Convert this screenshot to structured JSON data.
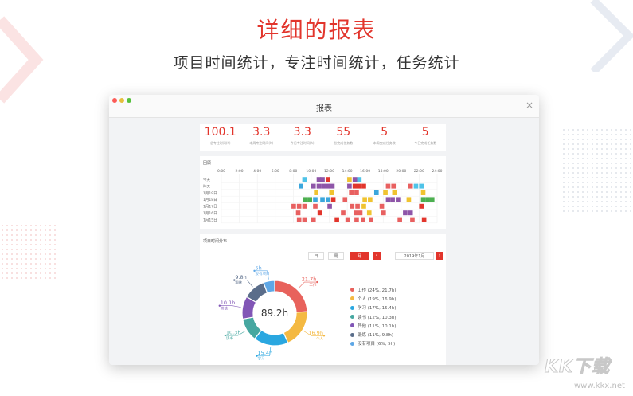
{
  "headline": "详细的报表",
  "subline": "项目时间统计，专注时间统计，任务统计",
  "window": {
    "title": "报表",
    "close_glyph": "×"
  },
  "stats": [
    {
      "value": "100.1",
      "label": "总专注时间(h)"
    },
    {
      "value": "3.3",
      "label": "本周专注时间(h)"
    },
    {
      "value": "3.3",
      "label": "今日专注时间(h)"
    },
    {
      "value": "55",
      "label": "总完成任务数"
    },
    {
      "value": "5",
      "label": "本周完成任务数"
    },
    {
      "value": "5",
      "label": "今日完成任务数"
    }
  ],
  "timeline": {
    "title": "回顾",
    "hours": [
      "0:00",
      "2:00",
      "4:00",
      "6:00",
      "8:00",
      "10:00",
      "12:00",
      "14:00",
      "16:00",
      "18:00",
      "20:00",
      "22:00",
      "24:00"
    ],
    "days": [
      "今天",
      "昨天",
      "1月19日",
      "1月18日",
      "1月17日",
      "1月16日",
      "1月15日"
    ],
    "blocks": [
      [
        [
          9,
          0.5,
          "#4fc3e8"
        ],
        [
          10.6,
          0.5,
          "#8e55a8"
        ],
        [
          11,
          0.5,
          "#8e55a8"
        ],
        [
          11.6,
          0.5,
          "#e2352c"
        ],
        [
          14,
          0.5,
          "#f0c330"
        ],
        [
          14.6,
          0.5,
          "#8e55a8"
        ],
        [
          15.1,
          0.5,
          "#4fc3e8"
        ]
      ],
      [
        [
          8.6,
          0.5,
          "#3aa6dc"
        ],
        [
          10,
          0.5,
          "#8e55a8"
        ],
        [
          10.6,
          0.5,
          "#8e55a8"
        ],
        [
          11.1,
          0.5,
          "#8e55a8"
        ],
        [
          11.6,
          0.5,
          "#8e55a8"
        ],
        [
          12.1,
          0.5,
          "#8e55a8"
        ],
        [
          14,
          0.5,
          "#8e55a8"
        ],
        [
          14.6,
          0.5,
          "#e2352c"
        ],
        [
          15.1,
          0.5,
          "#e2352c"
        ],
        [
          15.6,
          0.5,
          "#e2352c"
        ],
        [
          18.3,
          0.5,
          "#e86060"
        ],
        [
          18.9,
          0.5,
          "#e86060"
        ],
        [
          20.8,
          0.5,
          "#e86060"
        ],
        [
          21.4,
          0.5,
          "#4fc3e8"
        ],
        [
          22,
          0.5,
          "#4fc3e8"
        ]
      ],
      [
        [
          10.3,
          0.5,
          "#f0c330"
        ],
        [
          12,
          0.5,
          "#f0c330"
        ],
        [
          14.2,
          0.5,
          "#e86060"
        ],
        [
          14.8,
          0.5,
          "#e86060"
        ],
        [
          17,
          0.5,
          "#3aa6dc"
        ],
        [
          18,
          0.5,
          "#f0c330"
        ],
        [
          19,
          0.5,
          "#f0c330"
        ],
        [
          22.2,
          0.5,
          "#f0c330"
        ]
      ],
      [
        [
          9.1,
          0.5,
          "#4caf50"
        ],
        [
          9.6,
          0.5,
          "#4caf50"
        ],
        [
          10.2,
          0.5,
          "#3aa6dc"
        ],
        [
          11,
          0.5,
          "#3aa6dc"
        ],
        [
          11.6,
          0.5,
          "#3aa6dc"
        ],
        [
          12.2,
          0.5,
          "#e2352c"
        ],
        [
          13.5,
          0.5,
          "#e86060"
        ],
        [
          15.7,
          0.5,
          "#f0c330"
        ],
        [
          16.3,
          0.5,
          "#f0c330"
        ],
        [
          18.3,
          0.5,
          "#8e55a8"
        ],
        [
          18.8,
          0.5,
          "#8e55a8"
        ],
        [
          19.4,
          0.5,
          "#8e55a8"
        ],
        [
          20.6,
          0.5,
          "#f0c330"
        ],
        [
          22.2,
          0.5,
          "#4caf50"
        ],
        [
          22.7,
          0.5,
          "#4caf50"
        ],
        [
          23.2,
          0.5,
          "#4caf50"
        ]
      ],
      [
        [
          7.8,
          0.5,
          "#e86060"
        ],
        [
          8.4,
          0.5,
          "#e86060"
        ],
        [
          9,
          0.5,
          "#e86060"
        ],
        [
          10.2,
          0.5,
          "#e86060"
        ],
        [
          11.8,
          0.5,
          "#8e55a8"
        ],
        [
          14.3,
          0.5,
          "#e86060"
        ],
        [
          14.9,
          0.5,
          "#e86060"
        ],
        [
          15.6,
          0.5,
          "#f0c330"
        ],
        [
          17.6,
          0.5,
          "#e86060"
        ],
        [
          22,
          0.5,
          "#e2352c"
        ]
      ],
      [
        [
          8.3,
          0.5,
          "#e86060"
        ],
        [
          10.7,
          0.5,
          "#e2352c"
        ],
        [
          13.3,
          0.5,
          "#e86060"
        ],
        [
          14.7,
          0.5,
          "#e86060"
        ],
        [
          15.2,
          0.5,
          "#e86060"
        ],
        [
          16.2,
          0.5,
          "#f0c330"
        ],
        [
          17.8,
          0.5,
          "#e86060"
        ],
        [
          20.2,
          0.5,
          "#8e55a8"
        ],
        [
          20.8,
          0.5,
          "#8e55a8"
        ]
      ],
      [
        [
          8.4,
          0.5,
          "#e86060"
        ],
        [
          9,
          0.5,
          "#e86060"
        ],
        [
          10,
          0.5,
          "#e86060"
        ],
        [
          12.6,
          0.5,
          "#e2352c"
        ],
        [
          13.8,
          0.5,
          "#e86060"
        ],
        [
          14.8,
          0.5,
          "#e86060"
        ],
        [
          15.5,
          0.5,
          "#e86060"
        ],
        [
          16.4,
          0.5,
          "#e86060"
        ],
        [
          19.6,
          0.5,
          "#e86060"
        ],
        [
          21,
          0.5,
          "#e86060"
        ],
        [
          22.3,
          0.5,
          "#e2352c"
        ]
      ]
    ]
  },
  "distribution": {
    "title": "项目时间分布",
    "tabs": [
      "日",
      "周",
      "月"
    ],
    "active_tab": 2,
    "prev_glyph": "‹",
    "next_glyph": "›",
    "month": "2019年1月",
    "total": "89.2h",
    "slices": [
      {
        "name": "工作",
        "value": 21.7,
        "pct": "24%",
        "color": "#e8625c",
        "label": "21.7h",
        "outer_label": "工作"
      },
      {
        "name": "个人",
        "value": 16.9,
        "pct": "19%",
        "color": "#f4b942",
        "label": "16.9h",
        "outer_label": "个人"
      },
      {
        "name": "学习",
        "value": 15.4,
        "pct": "17%",
        "color": "#2aa7e0",
        "label": "15.4h",
        "outer_label": "学习"
      },
      {
        "name": "读书",
        "value": 10.3,
        "pct": "12%",
        "color": "#46a7a0",
        "label": "10.3h",
        "outer_label": "读书"
      },
      {
        "name": "其他",
        "value": 10.1,
        "pct": "11%",
        "color": "#8156b6",
        "label": "10.1h",
        "outer_label": "其他"
      },
      {
        "name": "锻炼",
        "value": 9.8,
        "pct": "11%",
        "color": "#5a6d8a",
        "label": "9.8h",
        "outer_label": "锻炼"
      },
      {
        "name": "没有项目",
        "value": 5,
        "pct": "6%",
        "color": "#5ea7e6",
        "label": "5h",
        "outer_label": "没有项目"
      }
    ]
  },
  "watermark": {
    "text": "KK下载",
    "url": "www.kkx.net"
  }
}
